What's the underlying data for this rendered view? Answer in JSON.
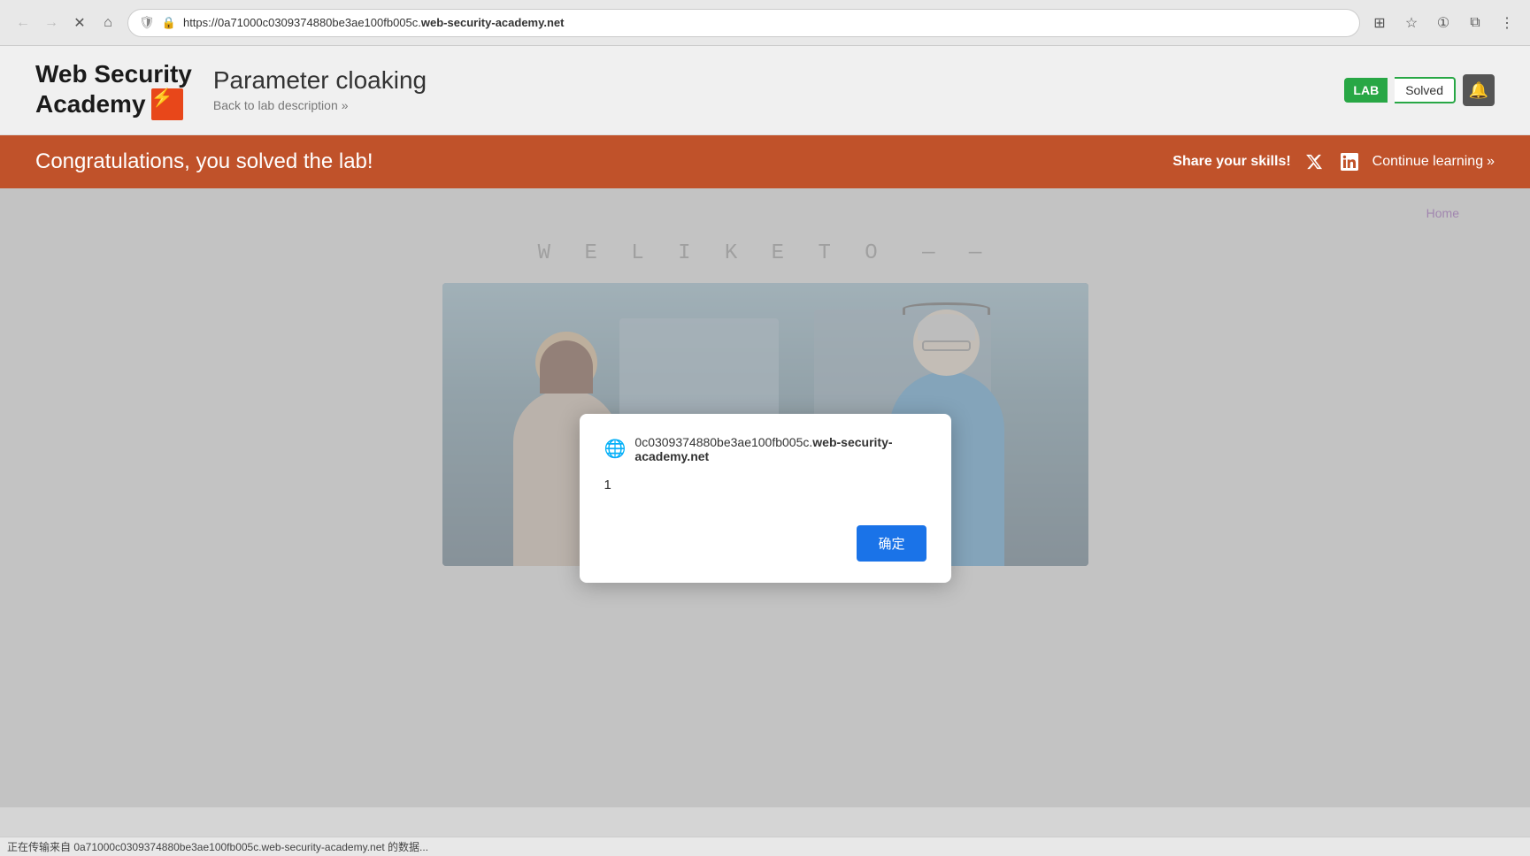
{
  "browser": {
    "url_prefix": "https://0a71000c0309374880be3ae100fb005c.",
    "url_domain": "web-security-academy.net",
    "url_full": "https://0a71000c0309374880be3ae100fb005c.web-security-academy.net"
  },
  "site_header": {
    "logo_line1": "Web Security",
    "logo_line2": "Academy",
    "logo_icon": "⚡",
    "lab_title": "Parameter cloaking",
    "back_link": "Back to lab description",
    "lab_badge": "LAB",
    "solved_label": "Solved",
    "alert_icon": "🔔"
  },
  "banner": {
    "congrats_text": "Congratulations, you solved the lab!",
    "share_label": "Share your skills!",
    "twitter_icon": "𝕏",
    "linkedin_icon": "in",
    "continue_label": "Continue learning",
    "continue_chevrons": "»"
  },
  "page": {
    "home_link": "Home",
    "we_like_to": "W E   L I K E   T O"
  },
  "dialog": {
    "url_prefix": "0c0309374880be3ae100fb005c.",
    "url_domain": "web-security-academy.net",
    "message": "1",
    "confirm_label": "确定"
  },
  "status_bar": {
    "text": "正在传输来自 0a71000c0309374880be3ae100fb005c.web-security-academy.net 的数据..."
  }
}
